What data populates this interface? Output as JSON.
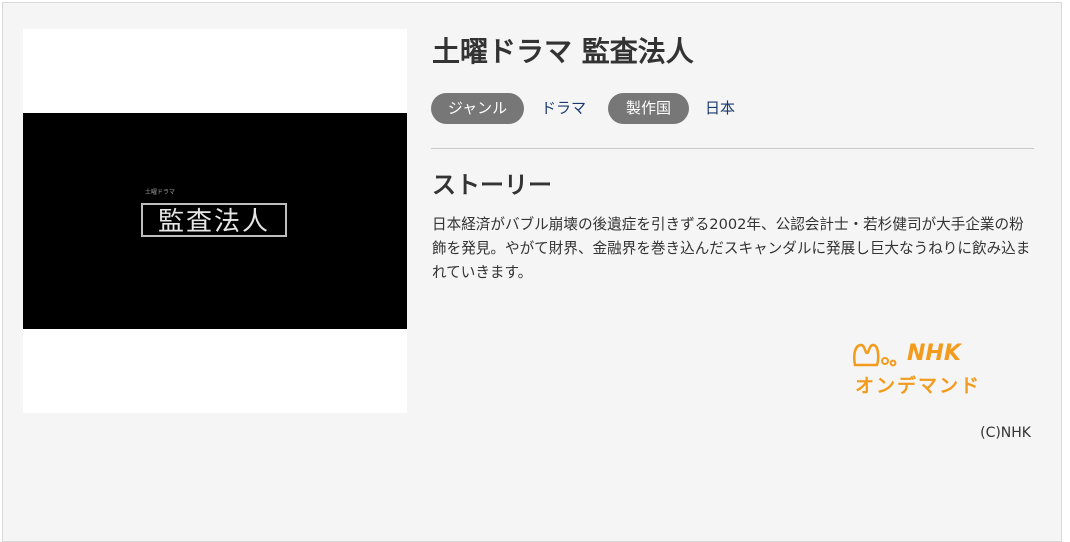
{
  "program": {
    "title": "土曜ドラマ 監査法人",
    "thumbnail_title": "監査法人",
    "thumbnail_subtitle": "土曜ドラマ"
  },
  "meta": {
    "genre_label": "ジャンル",
    "genre_value": "ドラマ",
    "country_label": "製作国",
    "country_value": "日本"
  },
  "story": {
    "heading": "ストーリー",
    "text": "日本経済がバブル崩壊の後遺症を引きずる2002年、公認会計士・若杉健司が大手企業の粉飾を発見。やがて財界、金融界を巻き込んだスキャンダルに発展し巨大なうねりに飲み込まれていきます。"
  },
  "logo": {
    "line1": "NHK",
    "line2": "オンデマンド",
    "color": "#f39b1c"
  },
  "copyright": "(C)NHK"
}
